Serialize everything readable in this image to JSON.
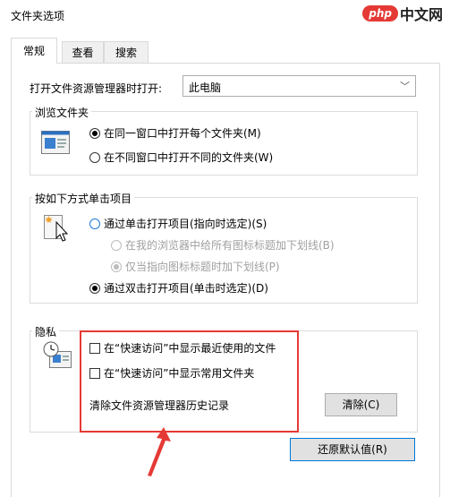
{
  "window": {
    "title": "文件夹选项"
  },
  "brand": {
    "badge": "php",
    "text": "中文网"
  },
  "tabs": [
    {
      "label": "常规",
      "active": true
    },
    {
      "label": "查看",
      "active": false
    },
    {
      "label": "搜索",
      "active": false
    }
  ],
  "general": {
    "open_explorer_label": "打开文件资源管理器时打开:",
    "open_explorer_value": "此电脑",
    "browse": {
      "legend": "浏览文件夹",
      "option_same": "在同一窗口中打开每个文件夹(M)",
      "option_new": "在不同窗口中打开不同的文件夹(W)"
    },
    "click": {
      "legend": "按如下方式单击项目",
      "single": "通过单击打开项目(指向时选定)(S)",
      "underline_all": "在我的浏览器中给所有图标标题加下划线(B)",
      "underline_point": "仅当指向图标标题时加下划线(P)",
      "double": "通过双击打开项目(单击时选定)(D)"
    },
    "privacy": {
      "legend": "隐私",
      "recent_files": "在“快速访问”中显示最近使用的文件",
      "frequent_folders": "在“快速访问”中显示常用文件夹",
      "clear_history_label": "清除文件资源管理器历史记录",
      "clear_button": "清除(C)"
    },
    "restore_defaults": "还原默认值(R)"
  },
  "colors": {
    "highlight": "#e53935",
    "focus": "#0078d7"
  }
}
